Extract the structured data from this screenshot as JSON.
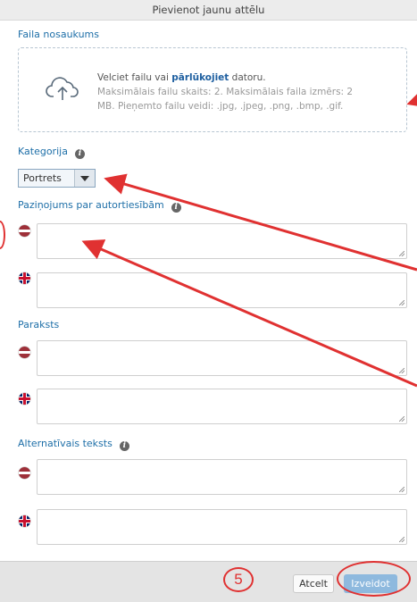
{
  "dialog": {
    "title": "Pievienot jaunu attēlu"
  },
  "file": {
    "label": "Faila nosaukums",
    "drop_text_prefix": "Velciet failu vai ",
    "browse_link": "pārlūkojiet",
    "drop_text_suffix": " datoru.",
    "limits_line1": "Maksimālais failu skaits: 2. Maksimālais faila izmērs: 2",
    "limits_line2": "MB. Pieņemto failu veidi: .jpg, .jpeg, .png, .bmp, .gif."
  },
  "category": {
    "label": "Kategorija",
    "selected": "Portrets"
  },
  "copyright": {
    "label": "Paziņojums par autortiesībām"
  },
  "caption": {
    "label": "Paraksts"
  },
  "alt_text": {
    "label": "Alternatīvais teksts"
  },
  "footer": {
    "callout_number": "5",
    "cancel_label": "Atcelt",
    "create_label": "Izveidot"
  },
  "icons": {
    "upload": "cloud-upload-icon",
    "info": "info-icon",
    "flag_lv": "flag-latvia-icon",
    "flag_uk": "flag-uk-icon",
    "resize": "resize-grip-icon"
  },
  "colors": {
    "label_blue": "#1e6fa8",
    "link_blue": "#1e5fa0",
    "primary_button": "#8eb9de",
    "annotation_red": "#e03131"
  }
}
